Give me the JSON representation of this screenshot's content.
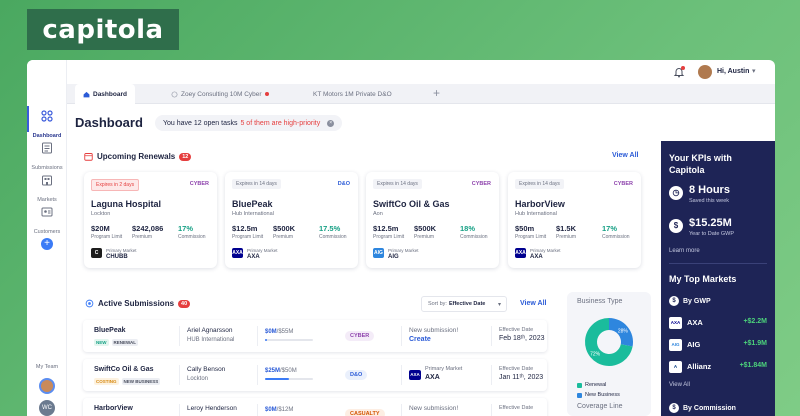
{
  "brand": {
    "logo": "capitola"
  },
  "sidebar": {
    "items": [
      {
        "label": "Dashboard"
      },
      {
        "label": "Submissions"
      },
      {
        "label": "Markets"
      },
      {
        "label": "Customers"
      }
    ],
    "plus": "+",
    "team_label": "My Team",
    "team_initials": "WC"
  },
  "topbar": {
    "greeting": "Hi, Austin",
    "chevron": "▾"
  },
  "tabs": [
    {
      "label": "Dashboard"
    },
    {
      "label": "Zoey Consulting 10M Cyber"
    },
    {
      "label": "KT Motors 1M Private D&O"
    }
  ],
  "header": {
    "title": "Dashboard",
    "tasks_text": "You have 12 open tasks",
    "tasks_highlight": "5 of them are high-priority",
    "close": "×"
  },
  "renewals": {
    "title": "Upcoming Renewals",
    "count": "12",
    "view_all": "View All",
    "cards": [
      {
        "expires": "Expires in 2 days",
        "tag": "CYBER",
        "name": "Laguna Hospital",
        "broker": "Lockton",
        "limit": "$20M",
        "limit_label": "Program Limit",
        "premium": "$242,086",
        "premium_label": "Premium",
        "commission": "17%",
        "commission_label": "Commission",
        "market_label": "Primary Market",
        "market": "CHUBB",
        "market_logo": "C",
        "market_color": "#1d1d1d"
      },
      {
        "expires": "Expires in 14 days",
        "tag": "D&O",
        "name": "BluePeak",
        "broker": "Hub International",
        "limit": "$12.5m",
        "limit_label": "Program Limit",
        "premium": "$500K",
        "premium_label": "Premium",
        "commission": "17.5%",
        "commission_label": "Commission",
        "market_label": "Primary Market",
        "market": "AXA",
        "market_logo": "AXA",
        "market_color": "#00008f"
      },
      {
        "expires": "Expires in 14 days",
        "tag": "CYBER",
        "name": "SwiftCo Oil & Gas",
        "broker": "Aon",
        "limit": "$12.5m",
        "limit_label": "Program Limit",
        "premium": "$500K",
        "premium_label": "Premium",
        "commission": "18%",
        "commission_label": "Commission",
        "market_label": "Primary Market",
        "market": "AIG",
        "market_logo": "AIG",
        "market_color": "#2e86de"
      },
      {
        "expires": "Expires in 14 days",
        "tag": "CYBER",
        "name": "HarborView",
        "broker": "Hub International",
        "limit": "$50m",
        "limit_label": "Program Limit",
        "premium": "$1.5K",
        "premium_label": "Premium",
        "commission": "17%",
        "commission_label": "Commission",
        "market_label": "Primary Market",
        "market": "AXA",
        "market_logo": "AXA",
        "market_color": "#00008f"
      }
    ]
  },
  "submissions": {
    "title": "Active Submissions",
    "count": "40",
    "sort_label": "Sort by:",
    "sort_value": "Effective Date",
    "view_all": "View All",
    "rows": [
      {
        "company": "BluePeak",
        "badge1": "NEW",
        "badge2": "RENEWAL",
        "person": "Ariel Agnarsson",
        "broker": "HUB International",
        "limit": "$0M",
        "limit_total": "/$55M",
        "progress": 0.05,
        "tag": "CYBER",
        "status_label": "New submission!",
        "status_action": "Create",
        "date_label": "Effective Date",
        "date": "Feb 18ᵗʰ, 2023"
      },
      {
        "company": "SwiftCo Oil & Gas",
        "badge1": "COSTING",
        "badge2": "NEW BUSINESS",
        "person": "Cally Benson",
        "broker": "Lockton",
        "limit": "$25M",
        "limit_total": "/$50M",
        "progress": 0.5,
        "tag": "D&O",
        "market_label": "Primary Market",
        "market": "AXA",
        "date_label": "Effective Date",
        "date": "Jan 11ᵗʰ, 2023"
      },
      {
        "company": "HarborView",
        "badge1": "",
        "badge2": "",
        "person": "Leroy Henderson",
        "broker": "",
        "limit": "$0M",
        "limit_total": "/$12M",
        "progress": 0.02,
        "tag": "CASUALTY",
        "status_label": "New submission!",
        "status_action": "",
        "date_label": "Effective Date",
        "date": ""
      }
    ]
  },
  "business_type": {
    "title": "Business Type",
    "renewal_pct": 28,
    "new_pct": 72,
    "renewal_label": "28%",
    "new_label": "72%",
    "legend_renewal": "Renewal",
    "legend_new": "New Business",
    "colors": {
      "renewal": "#2e86de",
      "new": "#1abc9c"
    },
    "coverage_title": "Coverage Line"
  },
  "kpis": {
    "title": "Your KPIs with Capitola",
    "hours_value": "8 Hours",
    "hours_label": "Saved this week",
    "gwp_value": "$15.25M",
    "gwp_label": "Year to Date GWP",
    "learn_more": "Learn more",
    "markets_title": "My Top Markets",
    "by_gwp": "By GWP",
    "markets": [
      {
        "name": "AXA",
        "value": "+$2.2M",
        "logo": "AXA",
        "color": "#00008f"
      },
      {
        "name": "AIG",
        "value": "+$1.9M",
        "logo": "AIG",
        "color": "#2e86de"
      },
      {
        "name": "Allianz",
        "value": "+$1.84M",
        "logo": "A",
        "color": "#003781"
      }
    ],
    "view_all": "View All",
    "by_commission": "By Commission"
  }
}
